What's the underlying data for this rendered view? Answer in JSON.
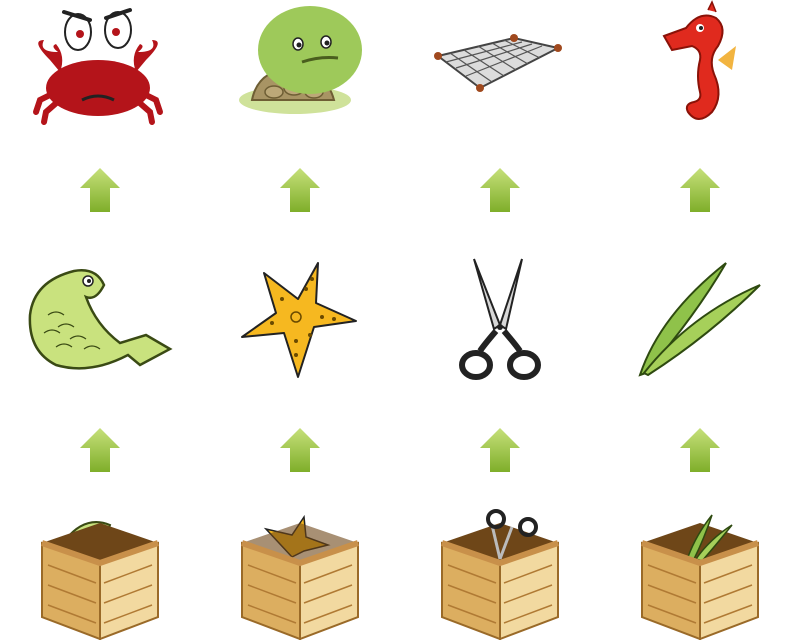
{
  "columns": [
    {
      "top": "crab",
      "middle": "fish",
      "box_content": "fish"
    },
    {
      "top": "turtle",
      "middle": "starfish",
      "box_content": "starfish"
    },
    {
      "top": "net",
      "middle": "scissors",
      "box_content": "scissors"
    },
    {
      "top": "seahorse",
      "middle": "seaweed",
      "box_content": "seaweed"
    }
  ],
  "icons": {
    "arrow": "up-arrow-icon",
    "box": "wooden-crate-icon"
  },
  "colors": {
    "arrow_light": "#c6e07a",
    "arrow_dark": "#7fae2a",
    "crate_light": "#f2d9a0",
    "crate_mid": "#dcae60",
    "crate_dark": "#b07a34",
    "crab": "#b4141a",
    "seahorse": "#e02a1e",
    "starfish": "#f6b820",
    "fish": "#c9e27e",
    "seaweed": "#8fc24a",
    "turtle_head": "#9ec95a",
    "turtle_shell": "#a89464"
  }
}
